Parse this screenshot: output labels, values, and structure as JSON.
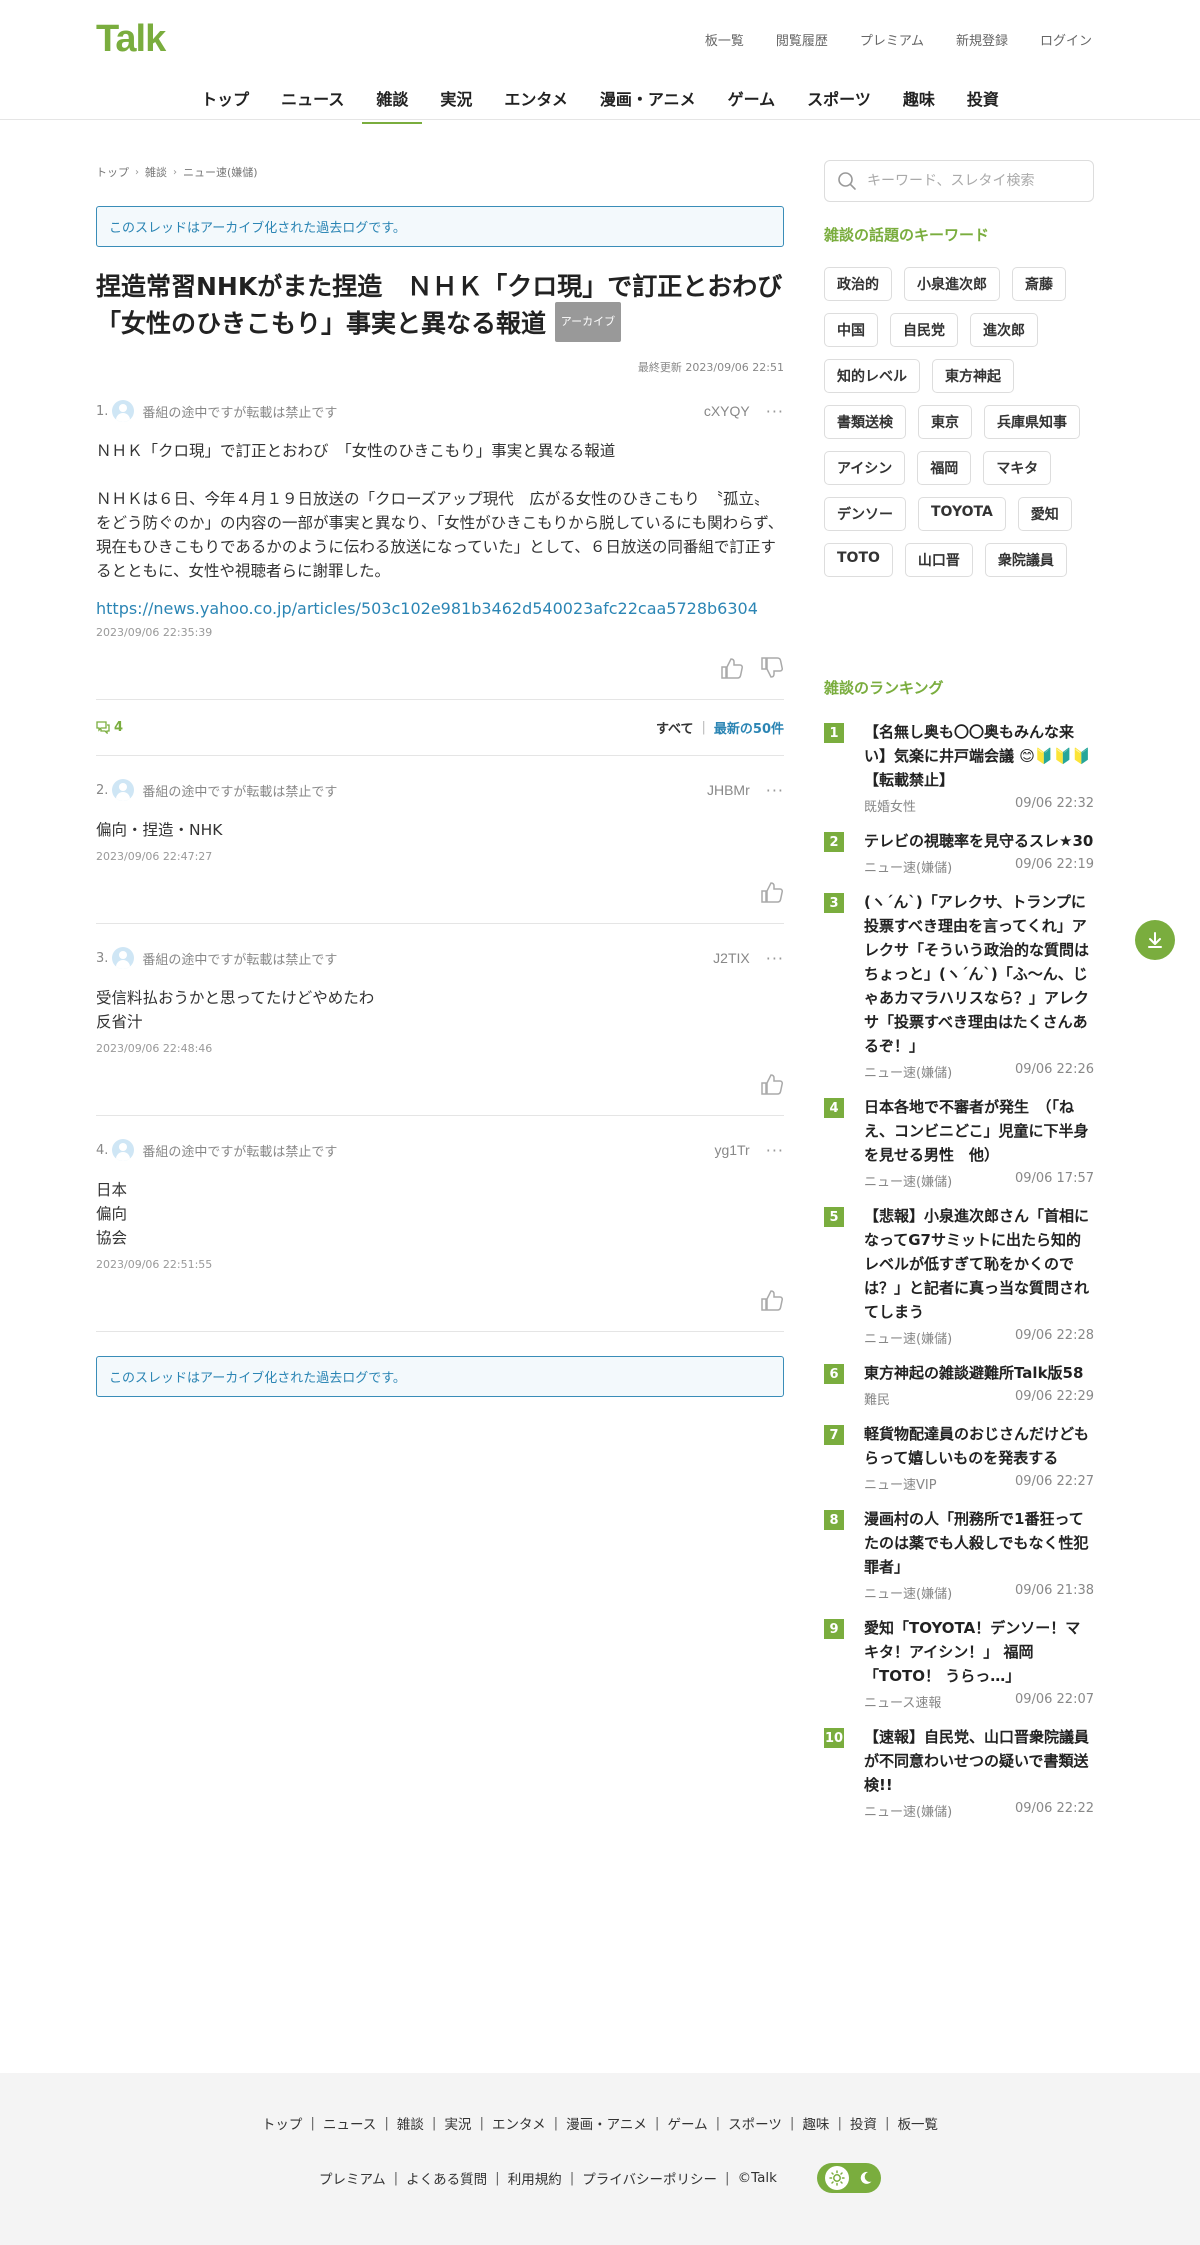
{
  "header": {
    "logo": "Talk",
    "top_links": [
      "板一覧",
      "閲覧履歴",
      "プレミアム",
      "新規登録",
      "ログイン"
    ],
    "nav": [
      "トップ",
      "ニュース",
      "雑談",
      "実況",
      "エンタメ",
      "漫画・アニメ",
      "ゲーム",
      "スポーツ",
      "趣味",
      "投資"
    ],
    "nav_active_index": 2
  },
  "breadcrumb": [
    "トップ",
    "雑談",
    "ニュー速(嫌儲)"
  ],
  "archive_notice": "このスレッドはアーカイブ化された過去ログです。",
  "thread": {
    "title": "捏造常習NHKがまた捏造　ＮＨＫ「クロ現」で訂正とおわび　「女性のひきこもり」事実と異なる報道",
    "badge": "アーカイブ",
    "updated": "最終更新 2023/09/06 22:51"
  },
  "posts": [
    {
      "num": "1.",
      "name": "番組の途中ですが転載は禁止です",
      "id": "cXYQY",
      "body": "ＮＨＫ「クロ現」で訂正とおわび　「女性のひきこもり」事実と異なる報道\n\nＮＨＫは６日、今年４月１９日放送の「クローズアップ現代　広がる女性のひきこもり　〝孤立〟をどう防ぐのか」の内容の一部が事実と異なり、「女性がひきこもりから脱しているにも関わらず、現在もひきこもりであるかのように伝わる放送になっていた」として、６日放送の同番組で訂正するとともに、女性や視聴者らに謝罪した。",
      "link": "https://news.yahoo.co.jp/articles/503c102e981b3462d540023afc22caa5728b6304",
      "date": "2023/09/06 22:35:39"
    },
    {
      "num": "2.",
      "name": "番組の途中ですが転載は禁止です",
      "id": "JHBMr",
      "body": "偏向・捏造・NHK",
      "date": "2023/09/06 22:47:27"
    },
    {
      "num": "3.",
      "name": "番組の途中ですが転載は禁止です",
      "id": "J2TIX",
      "body": "受信料払おうかと思ってたけどやめたわ\n反省汁",
      "date": "2023/09/06 22:48:46"
    },
    {
      "num": "4.",
      "name": "番組の途中ですが転載は禁止です",
      "id": "yg1Tr",
      "body": "日本\n偏向\n協会",
      "date": "2023/09/06 22:51:55"
    }
  ],
  "filterbar": {
    "count": "4",
    "all": "すべて",
    "latest": "最新の50件"
  },
  "sidebar": {
    "search_placeholder": "キーワード、スレタイ検索",
    "keywords_title": "雑談の話題のキーワード",
    "keywords": [
      "政治的",
      "小泉進次郎",
      "斎藤",
      "中国",
      "自民党",
      "進次郎",
      "知的レベル",
      "東方神起",
      "書類送検",
      "東京",
      "兵庫県知事",
      "アイシン",
      "福岡",
      "マキタ",
      "デンソー",
      "TOYOTA",
      "愛知",
      "TOTO",
      "山口晋",
      "衆院議員"
    ],
    "ranking_title": "雑談のランキング",
    "ranking": [
      {
        "rank": "1",
        "title": "【名無し奥も〇〇奥もみんな来い】気楽に井戸端会議 😊🔰🔰🔰【転載禁止】",
        "board": "既婚女性",
        "time": "09/06 22:32"
      },
      {
        "rank": "2",
        "title": "テレビの視聴率を見守るスレ★30",
        "board": "ニュー速(嫌儲)",
        "time": "09/06 22:19"
      },
      {
        "rank": "3",
        "title": "(ヽ´ん`)「アレクサ、トランプに投票すべき理由を言ってくれ」アレクサ「そういう政治的な質問はちょっと」(ヽ´ん`)「ふ～ん、じゃあカマラハリスなら？」アレクサ「投票すべき理由はたくさんあるぞ！」",
        "board": "ニュー速(嫌儲)",
        "time": "09/06 22:26"
      },
      {
        "rank": "4",
        "title": "日本各地で不審者が発生　（「ねえ、コンビニどこ」児童に下半身を見せる男性　他）",
        "board": "ニュー速(嫌儲)",
        "time": "09/06 17:57"
      },
      {
        "rank": "5",
        "title": "【悲報】小泉進次郎さん「首相になってG7サミットに出たら知的レベルが低すぎて恥をかくのでは？」と記者に真っ当な質問されてしまう",
        "board": "ニュー速(嫌儲)",
        "time": "09/06 22:28"
      },
      {
        "rank": "6",
        "title": "東方神起の雑談避難所Talk版58",
        "board": "難民",
        "time": "09/06 22:29"
      },
      {
        "rank": "7",
        "title": "軽貨物配達員のおじさんだけどもらって嬉しいものを発表する",
        "board": "ニュー速VIP",
        "time": "09/06 22:27"
      },
      {
        "rank": "8",
        "title": "漫画村の人「刑務所で1番狂ってたのは薬でも人殺しでもなく性犯罪者」",
        "board": "ニュー速(嫌儲)",
        "time": "09/06 21:38"
      },
      {
        "rank": "9",
        "title": "愛知「TOYOTA！デンソー！マキタ！アイシン！」 福岡「TOTO！ うらっ…」",
        "board": "ニュース速報",
        "time": "09/06 22:07"
      },
      {
        "rank": "10",
        "title": "【速報】自民党、山口晋衆院議員が不同意わいせつの疑いで書類送検!!",
        "board": "ニュー速(嫌儲)",
        "time": "09/06 22:22"
      }
    ]
  },
  "footer": {
    "row1": [
      "トップ",
      "ニュース",
      "雑談",
      "実況",
      "エンタメ",
      "漫画・アニメ",
      "ゲーム",
      "スポーツ",
      "趣味",
      "投資",
      "板一覧"
    ],
    "row2": [
      "プレミアム",
      "よくある質問",
      "利用規約",
      "プライバシーポリシー"
    ],
    "copyright": "©Talk"
  },
  "colors": {
    "brand_green": "#7aad3e",
    "link_blue": "#2b85b4"
  }
}
